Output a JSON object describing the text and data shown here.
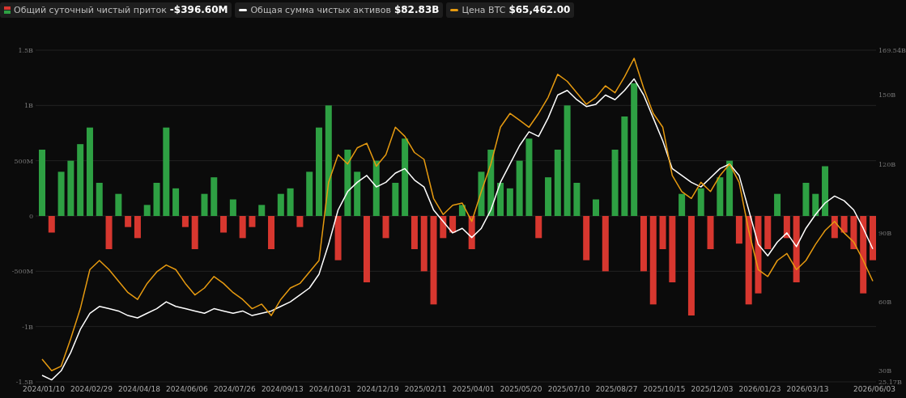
{
  "legend": [
    {
      "kind": "bar",
      "value": "-$396.60M"
    },
    {
      "kind": "line",
      "value": "$82.83B",
      "color": "#ffffff"
    },
    {
      "kind": "line",
      "value": "$65,462.00",
      "color": "#e69a10"
    }
  ],
  "chart": {
    "chart_data": {
      "type": "bar",
      "grid": true,
      "ylim": [
        -1500000000,
        1500000000
      ],
      "yticks": [
        {
          "value": 1500000000,
          "label": "1.5B"
        },
        {
          "value": 1000000000,
          "label": "1B"
        },
        {
          "value": 500000000,
          "label": "500M"
        },
        {
          "value": 0,
          "label": "0"
        },
        {
          "value": -500000000,
          "label": "-500M"
        },
        {
          "value": -1000000000,
          "label": "-1B"
        },
        {
          "value": -1500000000,
          "label": "-1.5B"
        }
      ],
      "y2lim": [
        25.17,
        169.54
      ],
      "y2ticks": [
        {
          "value": 169.54,
          "label": "169.54B"
        },
        {
          "value": 150,
          "label": "150B"
        },
        {
          "value": 120,
          "label": "120B"
        },
        {
          "value": 90,
          "label": "90B"
        },
        {
          "value": 60,
          "label": "60B"
        },
        {
          "value": 30,
          "label": "30B"
        },
        {
          "value": 25.17,
          "label": "25.17B"
        }
      ],
      "categories": [
        "2024/01/10",
        null,
        null,
        null,
        null,
        "2024/02/29",
        null,
        null,
        null,
        null,
        "2024/04/18",
        null,
        null,
        null,
        null,
        "2024/06/06",
        null,
        null,
        null,
        null,
        "2024/07/26",
        null,
        null,
        null,
        null,
        "2024/09/13",
        null,
        null,
        null,
        null,
        "2024/10/31",
        null,
        null,
        null,
        null,
        "2024/12/19",
        null,
        null,
        null,
        null,
        "2025/02/11",
        null,
        null,
        null,
        null,
        "2025/04/01",
        null,
        null,
        null,
        null,
        "2025/05/20",
        null,
        null,
        null,
        null,
        "2025/07/10",
        null,
        null,
        null,
        null,
        "2025/08/27",
        null,
        null,
        null,
        null,
        "2025/10/15",
        null,
        null,
        null,
        null,
        "2025/12/03",
        null,
        null,
        null,
        null,
        "2026/01/23",
        null,
        null,
        null,
        null,
        "2026/03/13",
        null,
        null,
        null,
        null,
        null,
        null,
        "2026/06/03"
      ],
      "series": [
        {
          "name": "Общий суточный чистый приток",
          "color": "#2ea043",
          "values": [
            600000000,
            null,
            400000000,
            500000000,
            650000000,
            800000000,
            300000000,
            null,
            200000000,
            null,
            null,
            100000000,
            300000000,
            800000000,
            250000000,
            null,
            null,
            200000000,
            350000000,
            null,
            150000000,
            null,
            null,
            100000000,
            null,
            200000000,
            250000000,
            null,
            400000000,
            800000000,
            1000000000,
            null,
            600000000,
            400000000,
            null,
            500000000,
            null,
            300000000,
            700000000,
            null,
            null,
            null,
            null,
            null,
            100000000,
            null,
            400000000,
            600000000,
            300000000,
            250000000,
            500000000,
            700000000,
            null,
            350000000,
            600000000,
            1000000000,
            300000000,
            null,
            150000000,
            null,
            600000000,
            900000000,
            1200000000,
            null,
            null,
            null,
            null,
            200000000,
            null,
            250000000,
            null,
            350000000,
            500000000,
            null,
            null,
            null,
            null,
            200000000,
            null,
            null,
            300000000,
            200000000,
            450000000,
            null,
            null,
            null,
            null,
            null
          ]
        },
        {
          "color": "#d7372f",
          "values": [
            null,
            -150000000,
            null,
            null,
            null,
            null,
            null,
            -300000000,
            null,
            -100000000,
            -200000000,
            null,
            null,
            null,
            null,
            -100000000,
            -300000000,
            null,
            null,
            -150000000,
            null,
            -200000000,
            -100000000,
            null,
            -300000000,
            null,
            null,
            -100000000,
            null,
            null,
            null,
            -400000000,
            null,
            null,
            -600000000,
            null,
            -200000000,
            null,
            null,
            -300000000,
            -500000000,
            -800000000,
            -200000000,
            -150000000,
            null,
            -300000000,
            null,
            null,
            null,
            null,
            null,
            null,
            -200000000,
            null,
            null,
            null,
            null,
            -400000000,
            null,
            -500000000,
            null,
            null,
            null,
            -500000000,
            -800000000,
            -300000000,
            -600000000,
            null,
            -900000000,
            null,
            -300000000,
            null,
            null,
            -250000000,
            -800000000,
            -700000000,
            -300000000,
            null,
            -200000000,
            -600000000,
            null,
            null,
            null,
            -200000000,
            -150000000,
            -300000000,
            -700000000,
            -400000000
          ]
        },
        {
          "name": "Общая сумма чистых активов",
          "type": "line",
          "axis": "y2",
          "color": "#ffffff",
          "values": [
            28,
            26,
            30,
            38,
            48,
            55,
            58,
            57,
            56,
            54,
            53,
            55,
            57,
            60,
            58,
            57,
            56,
            55,
            57,
            56,
            55,
            56,
            54,
            55,
            56,
            58,
            60,
            63,
            66,
            72,
            85,
            100,
            108,
            112,
            115,
            110,
            112,
            116,
            118,
            113,
            110,
            100,
            95,
            90,
            92,
            88,
            92,
            100,
            112,
            120,
            128,
            134,
            132,
            140,
            150,
            152,
            148,
            145,
            146,
            150,
            148,
            152,
            157,
            150,
            140,
            130,
            118,
            115,
            112,
            110,
            114,
            118,
            120,
            115,
            100,
            85,
            80,
            86,
            90,
            84,
            92,
            98,
            103,
            106,
            104,
            100,
            92,
            83
          ]
        },
        {
          "name": "Цена BTC",
          "type": "line",
          "axis": "y2",
          "color": "#e69a10",
          "values": [
            35,
            30,
            32,
            44,
            57,
            74,
            78,
            74,
            69,
            64,
            61,
            68,
            73,
            76,
            74,
            68,
            63,
            66,
            71,
            68,
            64,
            61,
            57,
            59,
            54,
            61,
            66,
            68,
            73,
            78,
            112,
            124,
            120,
            127,
            129,
            119,
            124,
            136,
            132,
            125,
            122,
            105,
            98,
            102,
            103,
            95,
            108,
            120,
            136,
            142,
            139,
            136,
            142,
            149,
            159,
            156,
            151,
            146,
            149,
            154,
            151,
            158,
            166,
            153,
            142,
            136,
            115,
            108,
            105,
            112,
            108,
            115,
            120,
            112,
            91,
            74,
            71,
            78,
            81,
            74,
            78,
            85,
            91,
            95,
            90,
            86,
            78,
            69
          ]
        }
      ]
    }
  }
}
